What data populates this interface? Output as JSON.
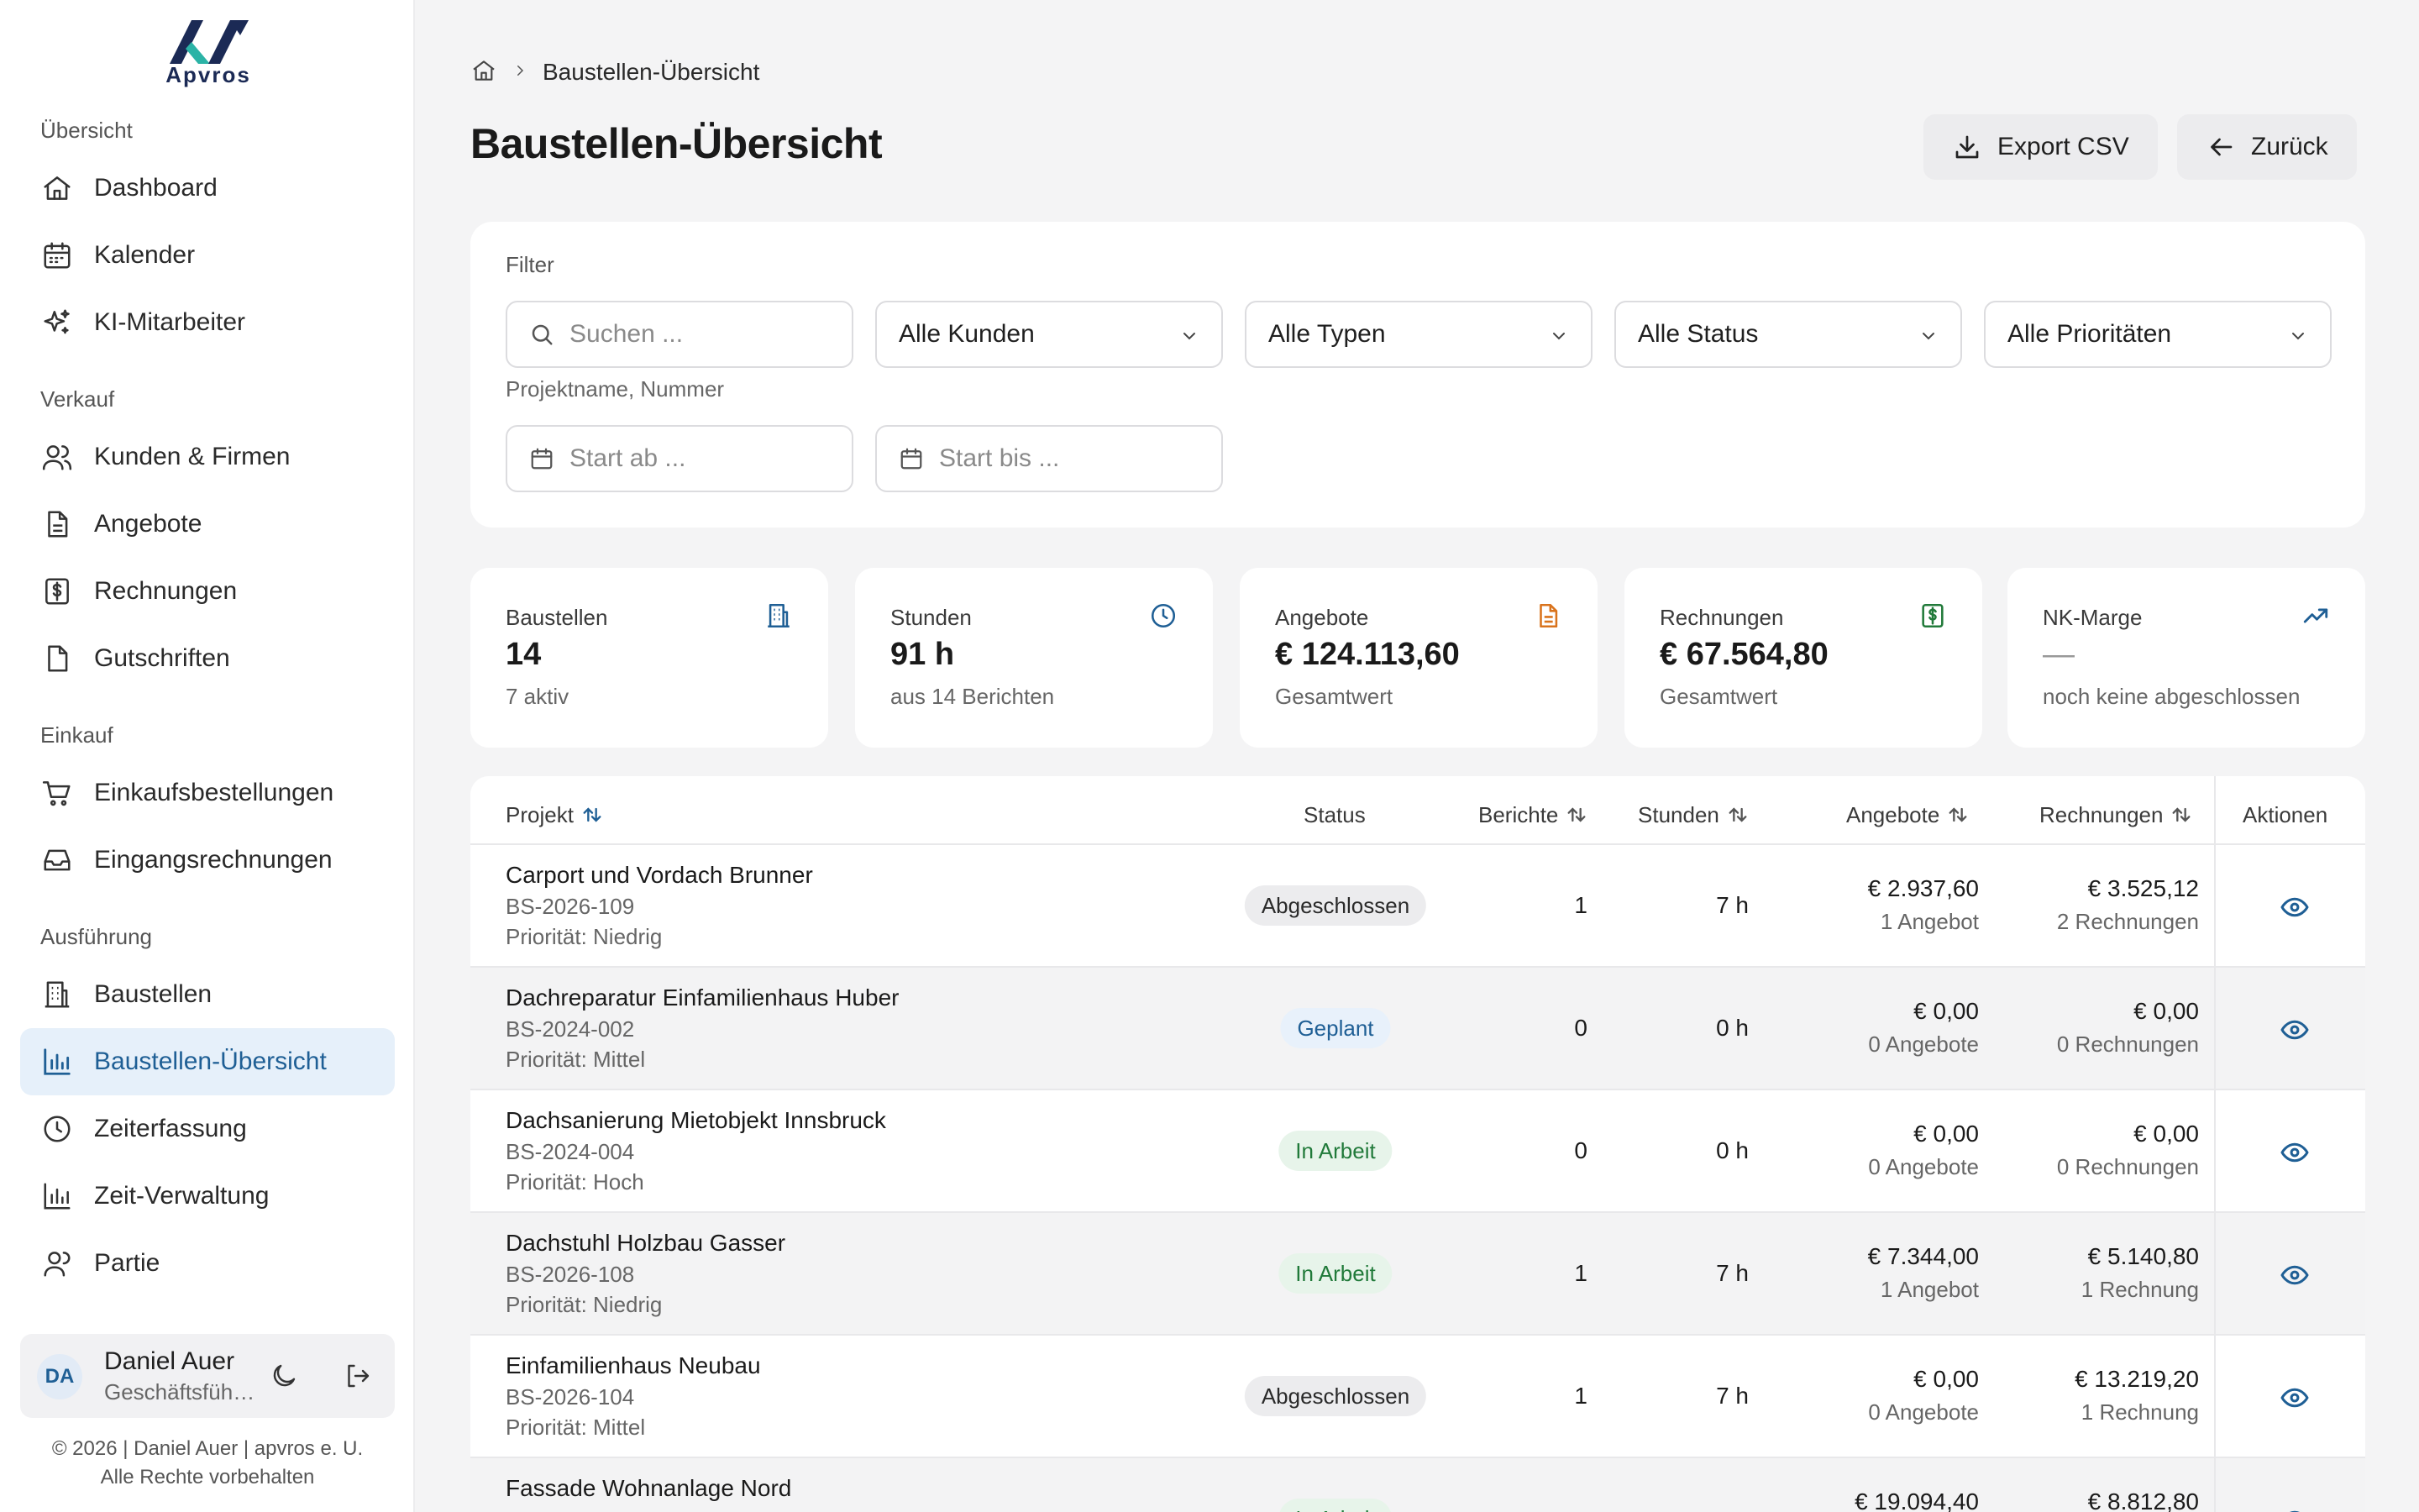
{
  "brand": {
    "name": "Apvros"
  },
  "sidebar": {
    "sections": [
      {
        "title": "Übersicht"
      },
      {
        "title": "Verkauf"
      },
      {
        "title": "Einkauf"
      },
      {
        "title": "Ausführung"
      }
    ],
    "items": [
      {
        "label": "Dashboard",
        "icon": "home-icon"
      },
      {
        "label": "Kalender",
        "icon": "calendar-icon"
      },
      {
        "label": "KI-Mitarbeiter",
        "icon": "sparkles-icon"
      },
      {
        "label": "Kunden & Firmen",
        "icon": "users-icon"
      },
      {
        "label": "Angebote",
        "icon": "document-icon"
      },
      {
        "label": "Rechnungen",
        "icon": "invoice-icon"
      },
      {
        "label": "Gutschriften",
        "icon": "file-icon"
      },
      {
        "label": "Einkaufsbestellungen",
        "icon": "cart-icon"
      },
      {
        "label": "Eingangsrechnungen",
        "icon": "inbox-icon"
      },
      {
        "label": "Baustellen",
        "icon": "building-icon"
      },
      {
        "label": "Baustellen-Übersicht",
        "icon": "bar-chart-icon",
        "active": true
      },
      {
        "label": "Zeiterfassung",
        "icon": "clock-icon"
      },
      {
        "label": "Zeit-Verwaltung",
        "icon": "bar-chart-icon"
      },
      {
        "label": "Partie",
        "icon": "users-icon"
      }
    ],
    "user": {
      "initials": "DA",
      "name": "Daniel Auer",
      "role": "Geschäftsführer"
    },
    "footer": {
      "line1": "© 2026 | Daniel Auer | apvros e. U.",
      "line2": "Alle Rechte vorbehalten"
    }
  },
  "breadcrumb": {
    "current": "Baustellen-Übersicht"
  },
  "page": {
    "title": "Baustellen-Übersicht"
  },
  "actions": {
    "export": "Export CSV",
    "back": "Zurück"
  },
  "filter": {
    "title": "Filter",
    "search_placeholder": "Suchen ...",
    "search_hint": "Projektname, Nummer",
    "customers": "Alle Kunden",
    "types": "Alle Typen",
    "status": "Alle Status",
    "priorities": "Alle Prioritäten",
    "start_from": "Start ab ...",
    "start_to": "Start bis ..."
  },
  "stats": [
    {
      "label": "Baustellen",
      "value": "14",
      "sub": "7 aktiv",
      "icon": "building-icon",
      "color": "#1f5f95"
    },
    {
      "label": "Stunden",
      "value": "91 h",
      "sub": "aus 14 Berichten",
      "icon": "clock-icon",
      "color": "#1f5f95"
    },
    {
      "label": "Angebote",
      "value": "€ 124.113,60",
      "sub": "Gesamtwert",
      "icon": "document-icon",
      "color": "#d9731c"
    },
    {
      "label": "Rechnungen",
      "value": "€ 67.564,80",
      "sub": "Gesamtwert",
      "icon": "invoice-icon",
      "color": "#217a3a"
    },
    {
      "label": "NK-Marge",
      "value": "—",
      "sub": "noch keine abgeschlossen",
      "icon": "trending-up-icon",
      "color": "#1f5f95"
    }
  ],
  "table": {
    "columns": {
      "project": "Projekt",
      "status": "Status",
      "reports": "Berichte",
      "hours": "Stunden",
      "offers": "Angebote",
      "invoices": "Rechnungen",
      "actions": "Aktionen"
    },
    "rows": [
      {
        "name": "Carport und Vordach Brunner",
        "number": "BS-2026-109",
        "priority": "Priorität: Niedrig",
        "status": "Abgeschlossen",
        "status_kind": "done",
        "reports": "1",
        "hours": "7 h",
        "offers": "€ 2.937,60",
        "offers_sub": "1 Angebot",
        "invoices": "€ 3.525,12",
        "invoices_sub": "2 Rechnungen"
      },
      {
        "name": "Dachreparatur Einfamilienhaus Huber",
        "number": "BS-2024-002",
        "priority": "Priorität: Mittel",
        "status": "Geplant",
        "status_kind": "plan",
        "reports": "0",
        "hours": "0 h",
        "offers": "€ 0,00",
        "offers_sub": "0 Angebote",
        "invoices": "€ 0,00",
        "invoices_sub": "0 Rechnungen"
      },
      {
        "name": "Dachsanierung Mietobjekt Innsbruck",
        "number": "BS-2024-004",
        "priority": "Priorität: Hoch",
        "status": "In Arbeit",
        "status_kind": "work",
        "reports": "0",
        "hours": "0 h",
        "offers": "€ 0,00",
        "offers_sub": "0 Angebote",
        "invoices": "€ 0,00",
        "invoices_sub": "0 Rechnungen"
      },
      {
        "name": "Dachstuhl Holzbau Gasser",
        "number": "BS-2026-108",
        "priority": "Priorität: Niedrig",
        "status": "In Arbeit",
        "status_kind": "work",
        "reports": "1",
        "hours": "7 h",
        "offers": "€ 7.344,00",
        "offers_sub": "1 Angebot",
        "invoices": "€ 5.140,80",
        "invoices_sub": "1 Rechnung"
      },
      {
        "name": "Einfamilienhaus Neubau",
        "number": "BS-2026-104",
        "priority": "Priorität: Mittel",
        "status": "Abgeschlossen",
        "status_kind": "done",
        "reports": "1",
        "hours": "7 h",
        "offers": "€ 0,00",
        "offers_sub": "0 Angebote",
        "invoices": "€ 13.219,20",
        "invoices_sub": "1 Rechnung"
      },
      {
        "name": "Fassade Wohnanlage Nord",
        "number": "",
        "priority": "",
        "status": "In Arbeit",
        "status_kind": "work",
        "reports": "",
        "hours": "",
        "offers": "€ 19.094,40",
        "offers_sub": "",
        "invoices": "€ 8.812,80",
        "invoices_sub": ""
      }
    ]
  }
}
